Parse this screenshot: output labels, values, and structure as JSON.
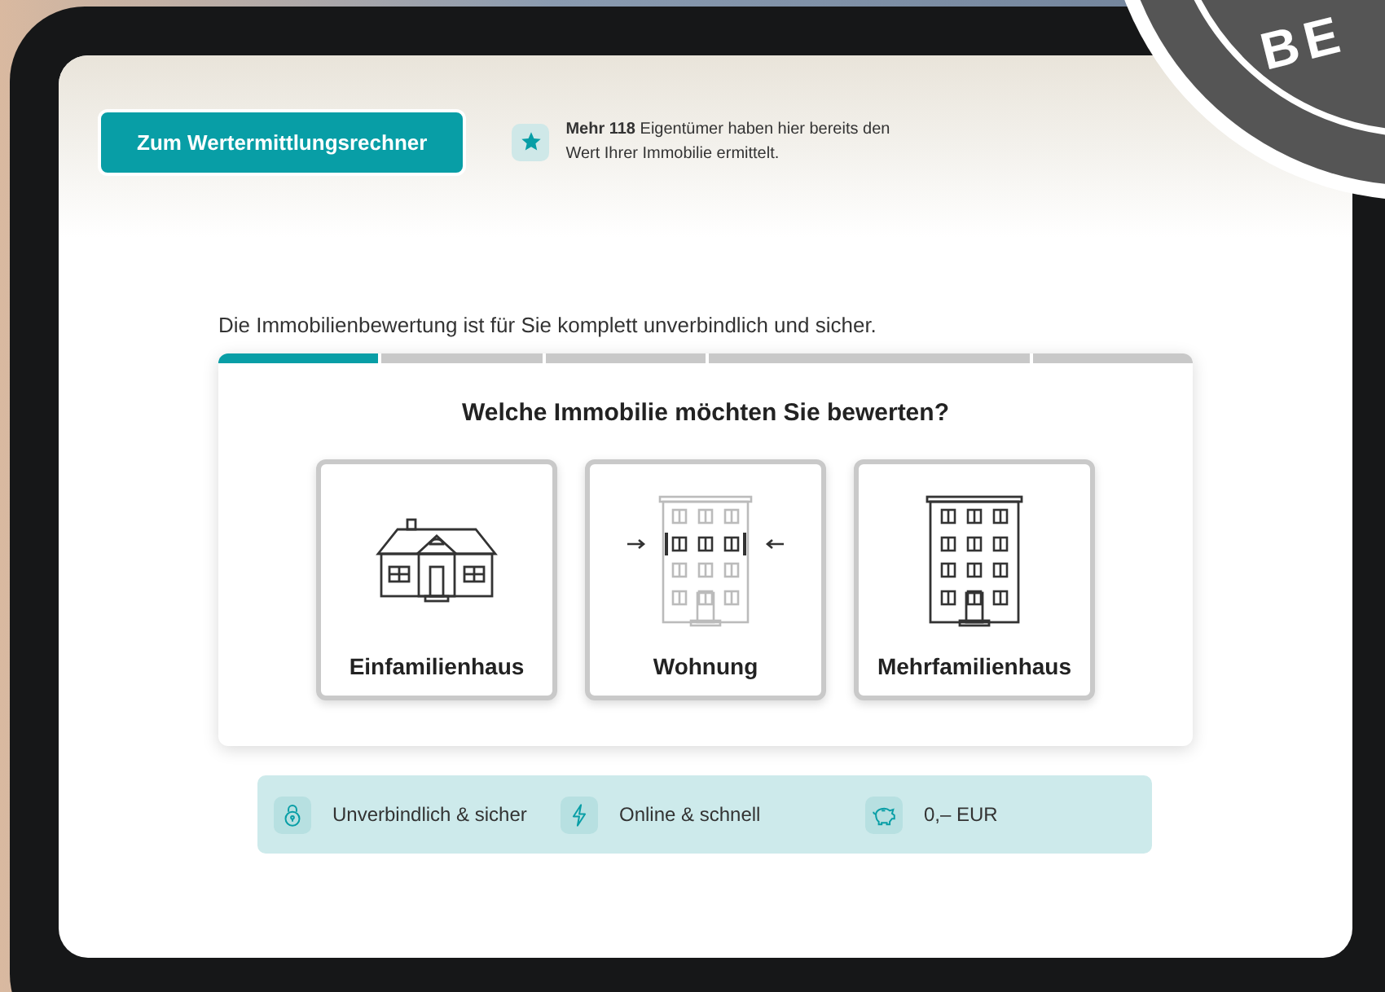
{
  "header": {
    "cta_button": "Zum Wertermittlungsrechner",
    "info": "**Mehr 118** Eigentümer haben hier bereits den Wert Ihrer Immobilie ermittelt."
  },
  "intro": "Die Immobilienbewertung ist für Sie komplett unverbindlich und sicher.",
  "progress": [
    {
      "done": true
    },
    {
      "done": false
    },
    {
      "done": false
    },
    {
      "done": false
    },
    {
      "done": false
    }
  ],
  "question": "Welche Immobilie möchten Sie bewerten?",
  "options": [
    {
      "kind": "house",
      "label": "Einfamilienhaus"
    },
    {
      "kind": "apartment",
      "label": "Wohnung"
    },
    {
      "kind": "multi",
      "label": "Mehrfamilienhaus"
    }
  ],
  "benefits": [
    {
      "kind": "lock",
      "label": "Unverbindlich & sicher"
    },
    {
      "kind": "bolt",
      "label": "Online & schnell"
    },
    {
      "kind": "piggy",
      "label": "0,– EUR"
    }
  ],
  "seal": {
    "text": "BE"
  }
}
